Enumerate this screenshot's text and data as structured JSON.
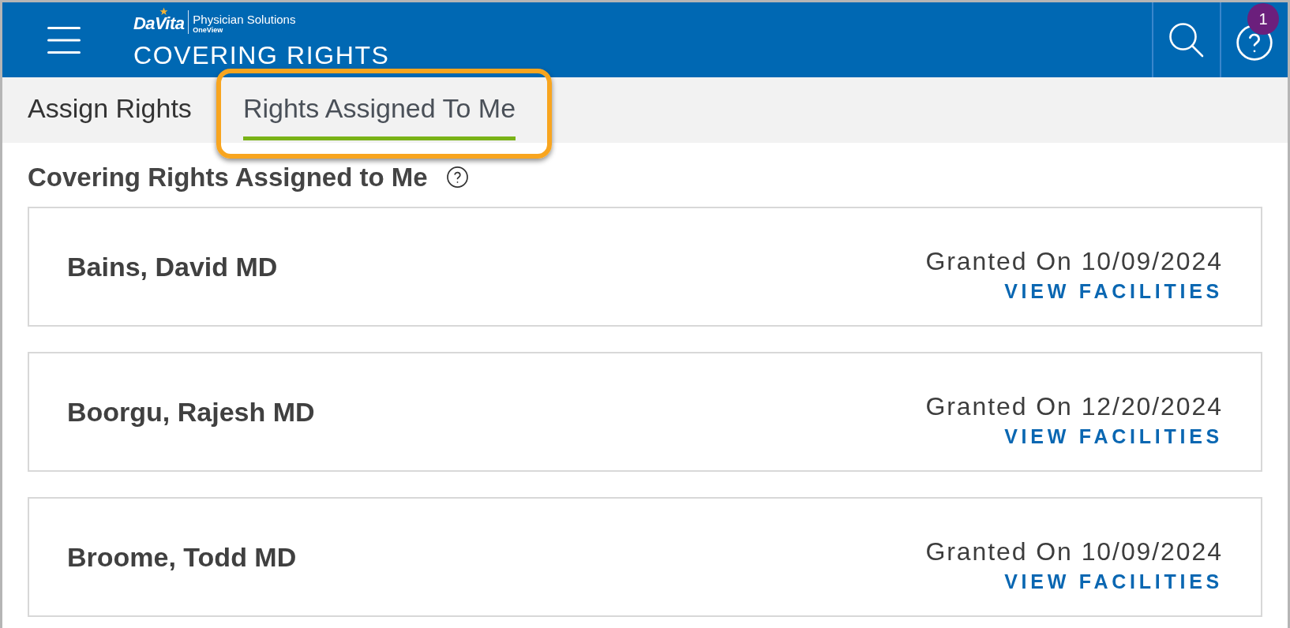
{
  "header": {
    "logo": {
      "brand": "DaVita",
      "product": "Physician Solutions",
      "edition": "OneView"
    },
    "title": "COVERING RIGHTS",
    "help_badge": "1"
  },
  "tabs": [
    {
      "label": "Assign Rights",
      "selected": false,
      "highlighted": false
    },
    {
      "label": "Rights Assigned To Me",
      "selected": true,
      "highlighted": true
    }
  ],
  "section": {
    "title": "Covering Rights Assigned to Me"
  },
  "assignments": [
    {
      "name": "Bains, David MD",
      "granted": "Granted On 10/09/2024",
      "action": "VIEW FACILITIES"
    },
    {
      "name": "Boorgu, Rajesh MD",
      "granted": "Granted On 12/20/2024",
      "action": "VIEW FACILITIES"
    },
    {
      "name": "Broome, Todd MD",
      "granted": "Granted On 10/09/2024",
      "action": "VIEW FACILITIES"
    }
  ]
}
